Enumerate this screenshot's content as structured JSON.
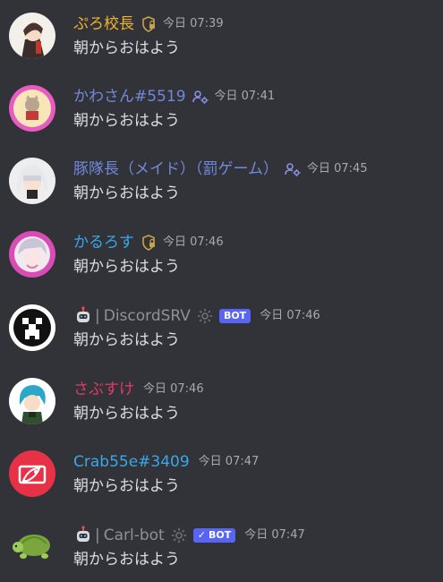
{
  "messages": [
    {
      "author": "ぷろ校長",
      "author_color": "#f0b232",
      "role_icon": "shield-icon",
      "timestamp": "今日 07:39",
      "content": "朝からおはよう"
    },
    {
      "author": "かわさん#5519",
      "author_color": "#7289da",
      "role_icon": "users-gear-icon",
      "timestamp": "今日 07:41",
      "content": "朝からおはよう"
    },
    {
      "author": "豚隊長（メイド）（罰ゲーム）",
      "author_color": "#7289da",
      "role_icon": "users-gear-icon",
      "timestamp": "今日 07:45",
      "content": "朝からおはよう"
    },
    {
      "author": "かるろす",
      "author_color": "#3ba7e8",
      "role_icon": "shield-icon",
      "timestamp": "今日 07:46",
      "content": "朝からおはよう"
    },
    {
      "author": "DiscordSRV",
      "author_color": "#8e9297",
      "separator": "|",
      "bot_badge": "BOT",
      "timestamp": "今日 07:46",
      "content": "朝からおはよう"
    },
    {
      "author": "さぶすけ",
      "author_color": "#e63968",
      "timestamp": "今日 07:46",
      "content": "朝からおはよう"
    },
    {
      "author": "Crab55e#3409",
      "author_color": "#3ba7e8",
      "timestamp": "今日 07:47",
      "content": "朝からおはよう"
    },
    {
      "author": "Carl-bot",
      "author_color": "#8e9297",
      "separator": "|",
      "bot_badge": "BOT",
      "bot_badge_check": "✓",
      "timestamp": "今日 07:47",
      "content": "朝からおはよう"
    }
  ]
}
